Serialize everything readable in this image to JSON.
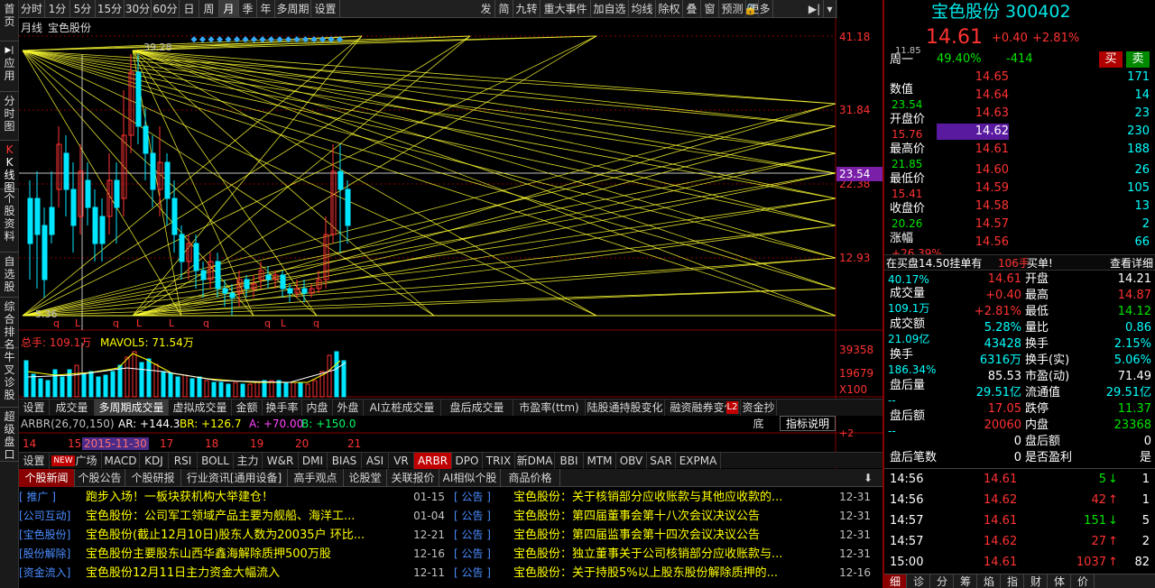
{
  "left_nav": [
    {
      "label": "首页",
      "icon": ""
    },
    {
      "label": "应用",
      "icon": "▶|"
    },
    {
      "label": "分时图",
      "icon": ""
    },
    {
      "label": "K线图",
      "icon": "K"
    },
    {
      "label": "个股资料",
      "icon": ""
    },
    {
      "label": "自选股",
      "icon": ""
    },
    {
      "label": "综合排名",
      "icon": ""
    },
    {
      "label": "牛叉诊股",
      "icon": ""
    },
    {
      "label": "超级盘口",
      "icon": ""
    }
  ],
  "toolbar": {
    "periods": [
      "分时",
      "1分",
      "5分",
      "15分",
      "30分",
      "60分",
      "日",
      "周",
      "月",
      "季",
      "年",
      "多周期",
      "设置"
    ],
    "active_period": "月",
    "right": [
      "发",
      "简",
      "九转",
      "重大事件",
      "加自选",
      "均线",
      "除权",
      "叠",
      "窗",
      "预测",
      "更多"
    ],
    "lock_icon": "lock-icon",
    "pin_icon": "pin-icon"
  },
  "chart": {
    "title_left": "月线",
    "title_stock": "宝色股份",
    "high_label": "39.28",
    "low_label": "5.36",
    "axis": [
      "41.18",
      "31.84",
      "22.38",
      "12.93"
    ],
    "current_price_tag": "23.54",
    "q_marks": [
      "q",
      "L",
      "q",
      "L",
      "L",
      "q",
      "q",
      "L",
      "q"
    ],
    "vol_title": "总手: 109.1万",
    "vol_ma": "MAVOL5: 71.54万",
    "vol_axis": [
      "39358",
      "19679",
      "X100"
    ]
  },
  "chart_tabs": {
    "items": [
      "设置",
      "成交量",
      "多周期成交量",
      "虚拟成交量",
      "金额",
      "换手率",
      "内盘",
      "外盘",
      "AI立桩成交量",
      "盘后成交量",
      "市盈率(ttm)",
      "陆股通持股变化",
      "融资融券变化",
      "资金抄底"
    ],
    "active": "多周期成交量",
    "badge": "L2"
  },
  "arbr": {
    "name": "ARBR(26,70,150)",
    "ar": "AR: +144.3",
    "br": "BR: +126.7",
    "a": "A: +70.00",
    "b": "B: +150.0",
    "explain": "指标说明",
    "tail_value": "+2",
    "dates": [
      "14",
      "15",
      "17",
      "18",
      "19",
      "20",
      "21"
    ],
    "cursor_date": "2015-11-30"
  },
  "ind_list": {
    "items": [
      "设置",
      "指标广场",
      "MACD",
      "KDJ",
      "RSI",
      "BOLL",
      "主力",
      "W&R",
      "DMI",
      "BIAS",
      "ASI",
      "VR",
      "ARBR",
      "DPO",
      "TRIX",
      "新DMA",
      "BBI",
      "MTM",
      "OBV",
      "SAR",
      "EXPMA"
    ],
    "active": "ARBR",
    "new_badge": "NEW"
  },
  "news": {
    "tabs": [
      "个股新闻",
      "个股公告",
      "个股研报",
      "行业资讯[通用设备]",
      "高手观点",
      "论股堂",
      "关联报价",
      "AI相似个股",
      "商品价格"
    ],
    "active": "个股新闻",
    "left": [
      {
        "tag": "[  推广  ]",
        "title": "跑步入场！一板块获机构大举建仓！",
        "date": "01-15"
      },
      {
        "tag": "[公司互动]",
        "title": "宝色股份：公司军工领域产品主要为舰船、海洋工...",
        "date": "01-04"
      },
      {
        "tag": "[宝色股份]",
        "title": "宝色股份(截止12月10日)股东人数为20035户 环比...",
        "date": "12-21"
      },
      {
        "tag": "[股份解除]",
        "title": "宝色股份主要股东山西华鑫海解除质押500万股",
        "date": "12-16"
      },
      {
        "tag": "[资金流入]",
        "title": "宝色股份12月11日主力资金大幅流入",
        "date": "12-11"
      }
    ],
    "right": [
      {
        "tag": "[  公告  ]",
        "title": "宝色股份：关于核销部分应收账款与其他应收款的...",
        "date": "12-31"
      },
      {
        "tag": "[  公告  ]",
        "title": "宝色股份：第四届董事会第十八次会议决议公告",
        "date": "12-31"
      },
      {
        "tag": "[  公告  ]",
        "title": "宝色股份：第四届监事会第十四次会议决议公告",
        "date": "12-31"
      },
      {
        "tag": "[  公告  ]",
        "title": "宝色股份：独立董事关于公司核销部分应收账款与...",
        "date": "12-31"
      },
      {
        "tag": "[  公告  ]",
        "title": "宝色股份：关于持股5%以上股东股份解除质押的...",
        "date": "12-16"
      }
    ]
  },
  "rp": {
    "stock": "宝色股份 300402",
    "price": "14.61",
    "change": "+0.40",
    "pct": "+2.81%",
    "weibi": "49.40%",
    "weicha": "-414",
    "buy": "买",
    "sell": "卖",
    "cycle": {
      "head": "11.85",
      "rows": [
        {
          "k": "周一",
          "v": ""
        },
        {
          "k": "数值",
          "v": "23.54"
        },
        {
          "k": "开盘价",
          "v": "15.76"
        },
        {
          "k": "最高价",
          "v": "21.85"
        },
        {
          "k": "最低价",
          "v": "15.41"
        },
        {
          "k": "收盘价",
          "v": "20.26"
        },
        {
          "k": "涨幅",
          "v": "+26.39%"
        }
      ]
    },
    "book": [
      {
        "p": "14.65",
        "v": "171"
      },
      {
        "p": "14.64",
        "v": "14"
      },
      {
        "p": "14.63",
        "v": "23"
      },
      {
        "p": "14.62",
        "v": "230"
      },
      {
        "p": "14.61",
        "v": "188"
      },
      {
        "p": "14.60",
        "v": "26"
      },
      {
        "p": "14.59",
        "v": "105"
      },
      {
        "p": "14.58",
        "v": "13"
      },
      {
        "p": "14.57",
        "v": "2"
      },
      {
        "p": "14.56",
        "v": "66"
      }
    ],
    "buyline": {
      "a": "在买盘14.50挂单有",
      "b": "106手",
      "c": "买单!",
      "d": "查看详细"
    },
    "pct2": "40.17%",
    "lefts": [
      {
        "k": "成交量",
        "v": "109.1万"
      },
      {
        "k": "成交额",
        "v": "21.09亿"
      },
      {
        "k": "换手",
        "v": "186.34%"
      },
      {
        "k": "盘后量",
        "v": "--"
      },
      {
        "k": "盘后额",
        "v": "--"
      }
    ],
    "stats": [
      {
        "a": "14.61",
        "ac": "red",
        "k": "开盘",
        "b": "14.21",
        "bc": "white"
      },
      {
        "a": "+0.40",
        "ac": "red",
        "k": "最高",
        "b": "14.87",
        "bc": "red"
      },
      {
        "a": "+2.81%",
        "ac": "red",
        "k": "最低",
        "b": "14.12",
        "bc": "green"
      },
      {
        "a": "5.28%",
        "ac": "cyan",
        "k": "量比",
        "b": "0.86",
        "bc": "cyan"
      },
      {
        "a": "43428",
        "ac": "cyan",
        "k": "换手",
        "b": "2.15%",
        "bc": "cyan"
      },
      {
        "a": "6316万",
        "ac": "cyan",
        "k": "换手(实)",
        "b": "5.06%",
        "bc": "cyan"
      },
      {
        "a": "85.53",
        "ac": "white",
        "k": "市盈(动)",
        "b": "71.49",
        "bc": "white"
      },
      {
        "a": "29.51亿",
        "ac": "cyan",
        "k": "流通值",
        "b": "29.51亿",
        "bc": "cyan"
      },
      {
        "a": "17.05",
        "ac": "red",
        "k": "跌停",
        "b": "11.37",
        "bc": "green"
      },
      {
        "a": "20060",
        "ac": "red",
        "k": "内盘",
        "b": "23368",
        "bc": "green"
      },
      {
        "a": "0",
        "ac": "white",
        "k": "盘后额",
        "b": "0",
        "bc": "white"
      },
      {
        "a": "0",
        "ac": "white",
        "k": "是否盈利",
        "b": "是",
        "bc": "white"
      }
    ],
    "stat_prefix": [
      "",
      "",
      "",
      "",
      "",
      "",
      "",
      "",
      "",
      "",
      "盘后量",
      ""
    ],
    "extra_left": "盘后笔数",
    "ticks": [
      {
        "t": "14:56",
        "p": "14.61",
        "pc": "red",
        "v": "5",
        "vc": "green",
        "dir": "down",
        "n": "1"
      },
      {
        "t": "14:56",
        "p": "14.62",
        "pc": "red",
        "v": "42",
        "vc": "red",
        "dir": "up",
        "n": "1"
      },
      {
        "t": "14:57",
        "p": "14.61",
        "pc": "red",
        "v": "151",
        "vc": "green",
        "dir": "down",
        "n": "5"
      },
      {
        "t": "14:57",
        "p": "14.62",
        "pc": "red",
        "v": "27",
        "vc": "red",
        "dir": "up",
        "n": "2"
      },
      {
        "t": "15:00",
        "p": "14.61",
        "pc": "red",
        "v": "1037",
        "vc": "red",
        "dir": "up",
        "n": "82"
      }
    ],
    "bottom_tabs": [
      "细",
      "诊",
      "分",
      "筹",
      "焰",
      "指",
      "财",
      "体",
      "价"
    ],
    "bottom_active": "细"
  },
  "colors": {
    "red": "#ff3232",
    "green": "#00e600",
    "cyan": "#00ffff",
    "yellow": "#ffff00",
    "brand": "#8a0000"
  }
}
